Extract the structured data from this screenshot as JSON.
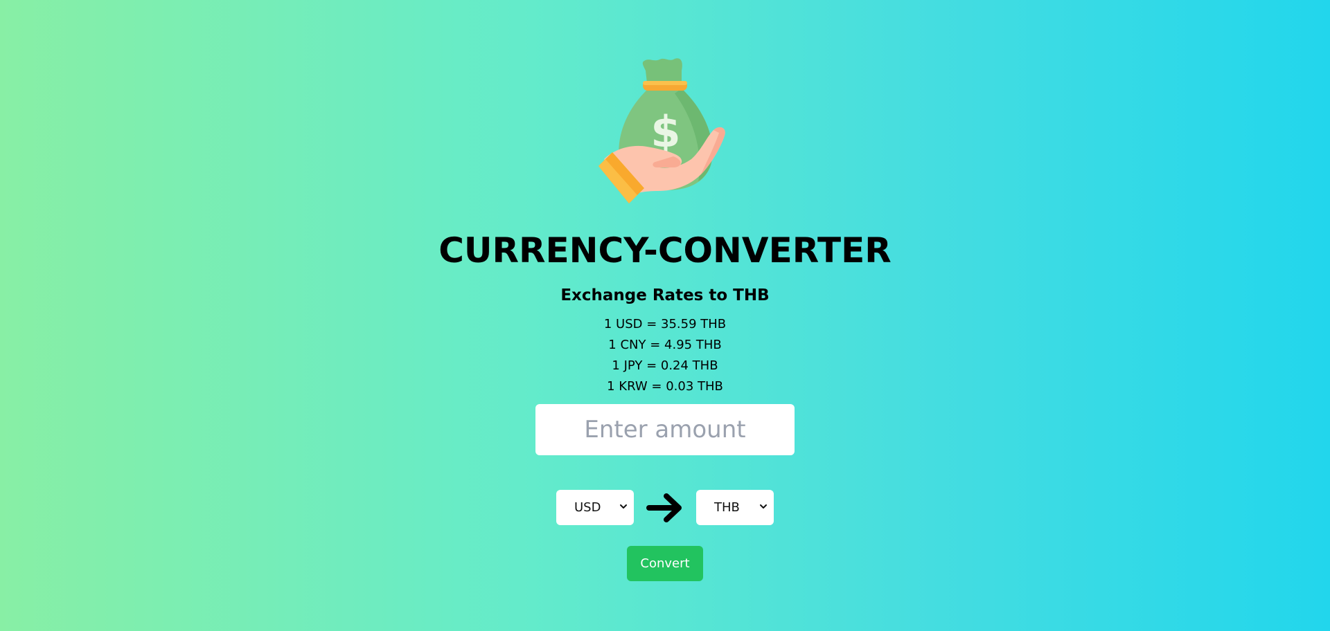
{
  "app": {
    "title": "CURRENCY-CONVERTER",
    "subtitle": "Exchange Rates to THB",
    "logo_icon": "money-bag-hand-icon"
  },
  "rates": [
    {
      "text": "1 USD = 35.59 THB",
      "currency": "USD",
      "value": 35.59
    },
    {
      "text": "1 CNY = 4.95 THB",
      "currency": "CNY",
      "value": 4.95
    },
    {
      "text": "1 JPY = 0.24 THB",
      "currency": "JPY",
      "value": 0.24
    },
    {
      "text": "1 KRW = 0.03 THB",
      "currency": "KRW",
      "value": 0.03
    }
  ],
  "amount": {
    "value": "",
    "placeholder": "Enter amount"
  },
  "from_currency": {
    "selected": "USD"
  },
  "to_currency": {
    "selected": "THB"
  },
  "arrow_icon": "arrow-right-icon",
  "convert_button": {
    "label": "Convert"
  },
  "colors": {
    "gradient_start": "#88efa5",
    "gradient_end": "#22d6ec",
    "button": "#22c35f",
    "bag": "#7cc47e",
    "bag_tie": "#f7a833",
    "hand": "#fdbfa8",
    "cuff": "#f9a92d"
  }
}
